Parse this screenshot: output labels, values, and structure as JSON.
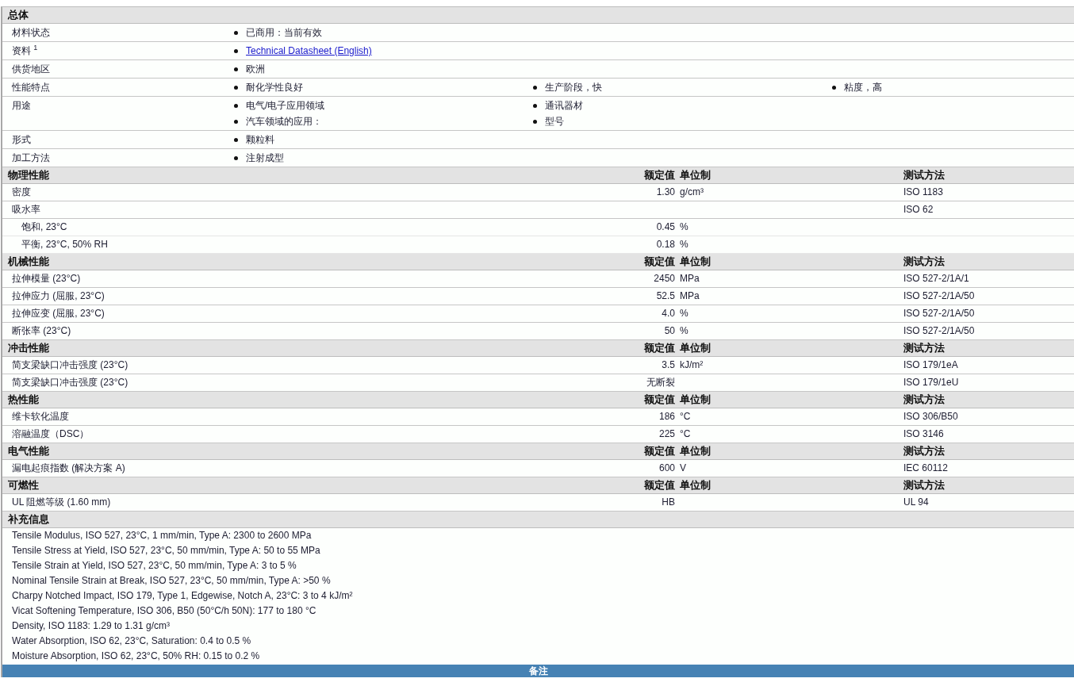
{
  "general": {
    "title": "总体",
    "rows": [
      {
        "label": "材料状态",
        "item_columns": [
          [
            {
              "text": "已商用：当前有效"
            }
          ]
        ]
      },
      {
        "label": "资料 $^{1}$",
        "item_columns": [
          [
            {
              "text": "Technical Datasheet (English)",
              "kind": "link"
            }
          ]
        ]
      },
      {
        "label": "供货地区",
        "item_columns": [
          [
            {
              "text": "欧洲"
            }
          ]
        ]
      },
      {
        "label": "性能特点",
        "item_columns": [
          [
            {
              "text": "耐化学性良好"
            }
          ],
          [
            {
              "text": "生产阶段，快"
            }
          ],
          [
            {
              "text": "粘度，高"
            }
          ]
        ]
      },
      {
        "label": "用途",
        "item_columns": [
          [
            {
              "text": "电气/电子应用领域"
            },
            {
              "text": "汽车领域的应用："
            }
          ],
          [
            {
              "text": "通讯器材"
            },
            {
              "text": "型号"
            }
          ]
        ]
      },
      {
        "label": "形式",
        "item_columns": [
          [
            {
              "text": "颗粒料"
            }
          ]
        ]
      },
      {
        "label": "加工方法",
        "item_columns": [
          [
            {
              "text": "注射成型"
            }
          ]
        ]
      }
    ]
  },
  "property_sections": [
    {
      "title": "物理性能",
      "columns": [
        "额定值",
        "单位制",
        "测试方法"
      ],
      "rows": [
        {
          "label": "密度",
          "value": "1.30",
          "unit": "g/cm³",
          "method": "ISO 1183"
        },
        {
          "label": "吸水率",
          "method": "ISO 62",
          "children": [
            {
              "label": "饱和, 23°C",
              "value": "0.45",
              "unit": "%"
            },
            {
              "label": "平衡, 23°C, 50% RH",
              "value": "0.18",
              "unit": "%"
            }
          ]
        }
      ]
    },
    {
      "title": "机械性能",
      "columns": [
        "额定值",
        "单位制",
        "测试方法"
      ],
      "rows": [
        {
          "label": "拉伸模量 (23°C)",
          "value": "2450",
          "unit": "MPa",
          "method": "ISO 527-2/1A/1"
        },
        {
          "label": "拉伸应力 (屈服, 23°C)",
          "value": "52.5",
          "unit": "MPa",
          "method": "ISO 527-2/1A/50"
        },
        {
          "label": "拉伸应变 (屈服, 23°C)",
          "value": "4.0",
          "unit": "%",
          "method": "ISO 527-2/1A/50"
        },
        {
          "label": "断张率 (23°C)",
          "value": "50",
          "unit": "%",
          "method": "ISO 527-2/1A/50"
        }
      ]
    },
    {
      "title": "冲击性能",
      "columns": [
        "额定值",
        "单位制",
        "测试方法"
      ],
      "rows": [
        {
          "label": "简支梁缺口冲击强度 (23°C)",
          "value": "3.5",
          "unit": "kJ/m²",
          "method": "ISO 179/1eA"
        },
        {
          "label": "简支梁缺口冲击强度 (23°C)",
          "value": "无断裂",
          "method": "ISO 179/1eU"
        }
      ]
    },
    {
      "title": "热性能",
      "columns": [
        "额定值",
        "单位制",
        "测试方法"
      ],
      "rows": [
        {
          "label": "维卡软化温度",
          "value": "186",
          "unit": "°C",
          "method": "ISO 306/B50"
        },
        {
          "label": "溶融温度（DSC）",
          "value": "225",
          "unit": "°C",
          "method": "ISO 3146"
        }
      ]
    },
    {
      "title": "电气性能",
      "columns": [
        "额定值",
        "单位制",
        "测试方法"
      ],
      "rows": [
        {
          "label": "漏电起痕指数 (解决方案 A)",
          "value": "600",
          "unit": "V",
          "method": "IEC 60112"
        }
      ]
    },
    {
      "title": "可燃性",
      "columns": [
        "额定值",
        "单位制",
        "测试方法"
      ],
      "rows": [
        {
          "label": "UL 阻燃等级 (1.60 mm)",
          "value": "HB",
          "method": "UL 94"
        }
      ]
    }
  ],
  "supplementary": {
    "title": "补充信息",
    "lines": [
      "Tensile Modulus, ISO 527, 23°C, 1 mm/min, Type A: 2300 to 2600 MPa",
      "Tensile Stress at Yield, ISO 527, 23°C, 50 mm/min, Type A: 50 to 55 MPa",
      "Tensile Strain at Yield, ISO 527, 23°C, 50 mm/min, Type A: 3 to 5 %",
      "Nominal Tensile Strain at Break, ISO 527, 23°C, 50 mm/min, Type A: >50 %",
      "Charpy Notched Impact, ISO 179, Type 1, Edgewise, Notch A, 23°C: 3 to 4 kJ/m²",
      "Vicat Softening Temperature, ISO 306, B50 (50°C/h 50N): 177 to 180 °C",
      "Density, ISO 1183: 1.29 to 1.31 g/cm³",
      "Water Absorption, ISO 62, 23°C, Saturation: 0.4 to 0.5 %",
      "Moisture Absorption, ISO 62, 23°C, 50% RH: 0.15 to 0.2 %"
    ]
  },
  "notes_bar": {
    "title": "备注"
  }
}
